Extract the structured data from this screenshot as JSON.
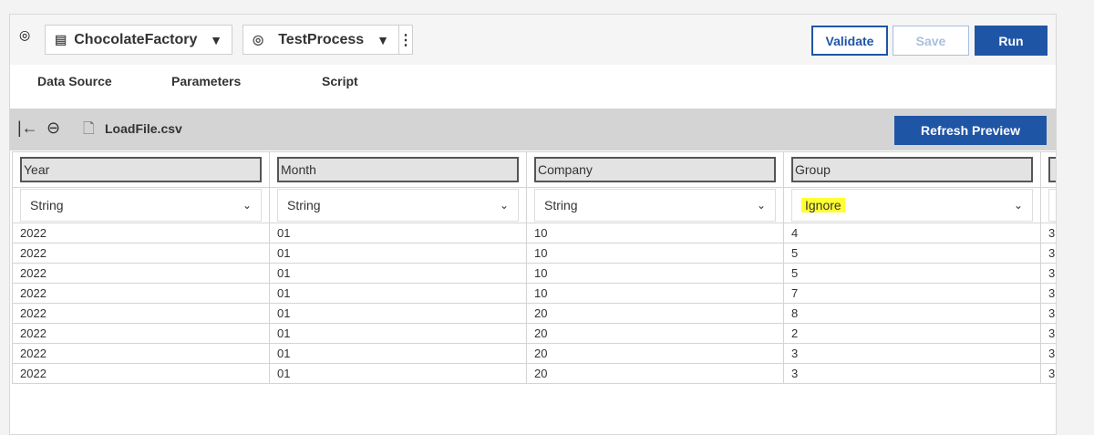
{
  "header": {
    "project": "ChocolateFactory",
    "process": "TestProcess",
    "validate": "Validate",
    "save": "Save",
    "run": "Run"
  },
  "tabs": [
    "Data Source",
    "Parameters",
    "Script"
  ],
  "toolbar": {
    "file": "LoadFile.csv",
    "refresh": "Refresh Preview"
  },
  "columns": [
    {
      "name": "Year",
      "type": "String"
    },
    {
      "name": "Month",
      "type": "String"
    },
    {
      "name": "Company",
      "type": "String"
    },
    {
      "name": "Group",
      "type": "Ignore"
    },
    {
      "name": "",
      "type": ""
    }
  ],
  "rows": [
    [
      "2022",
      "01",
      "10",
      "4",
      "3"
    ],
    [
      "2022",
      "01",
      "10",
      "5",
      "3"
    ],
    [
      "2022",
      "01",
      "10",
      "5",
      "3"
    ],
    [
      "2022",
      "01",
      "10",
      "7",
      "3"
    ],
    [
      "2022",
      "01",
      "20",
      "8",
      "3"
    ],
    [
      "2022",
      "01",
      "20",
      "2",
      "3"
    ],
    [
      "2022",
      "01",
      "20",
      "3",
      "3"
    ],
    [
      "2022",
      "01",
      "20",
      "3",
      "3"
    ]
  ],
  "colors": {
    "accent": "#1f55a5",
    "highlight": "#ffff33"
  }
}
